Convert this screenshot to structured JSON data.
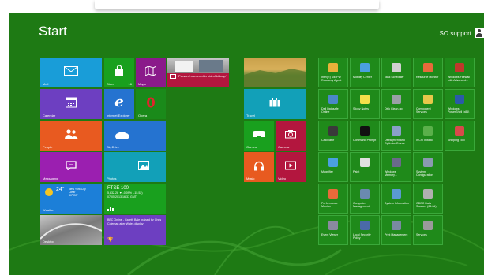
{
  "title": "Start",
  "user": {
    "name": "SO support"
  },
  "tiles": {
    "mail": {
      "label": "Mail"
    },
    "store": {
      "label": "Store",
      "badge": "16"
    },
    "maps": {
      "label": "Maps"
    },
    "photo_news": {
      "label": "Person 'murdered in bid of kidnap'"
    },
    "calendar": {
      "label": "Calendar"
    },
    "ie": {
      "label": "Internet Explorer"
    },
    "opera": {
      "label": "Opera"
    },
    "people": {
      "label": "People"
    },
    "skydrive": {
      "label": "SkyDrive"
    },
    "messaging": {
      "label": "Messaging"
    },
    "photos": {
      "label": "Photos"
    },
    "weather": {
      "label": "Weather",
      "temp": "24°",
      "city": "New York City",
      "cond": "Clear",
      "range": "30°/22°"
    },
    "finance": {
      "label": "FTSE 100",
      "value": "5,832.28 ▼ -0.09% (-15.52)",
      "date": "07/05/2013 16:37 GMT"
    },
    "desktop": {
      "label": "Desktop"
    },
    "sport": {
      "label": "BBC Online - Gareth Bale praised by Chris Coleman after Wales display"
    },
    "travel": {
      "label": "Travel"
    },
    "games": {
      "label": "Games"
    },
    "camera": {
      "label": "Camera"
    },
    "music": {
      "label": "Music"
    },
    "video": {
      "label": "Video"
    }
  },
  "admin_tiles": [
    {
      "label": "Intel(R) ME FW Recovery Agent",
      "color": "#e8b23a"
    },
    {
      "label": "Mobility Center",
      "color": "#4aa0e0"
    },
    {
      "label": "Task Scheduler",
      "color": "#d0d0d0"
    },
    {
      "label": "Resource Monitor",
      "color": "#e86a3a"
    },
    {
      "label": "Windows Firewall with Advanced...",
      "color": "#c0392b"
    },
    {
      "label": "Dell Datasafe Online",
      "color": "#4a88c8"
    },
    {
      "label": "Sticky Notes",
      "color": "#f5e04a"
    },
    {
      "label": "Disk Clean-up",
      "color": "#9aa0a6"
    },
    {
      "label": "Component Services",
      "color": "#e8c84a"
    },
    {
      "label": "Windows PowerShell (x86)",
      "color": "#2a5aa8"
    },
    {
      "label": "Calculator",
      "color": "#3a3a3a"
    },
    {
      "label": "Command Prompt",
      "color": "#111111"
    },
    {
      "label": "Defragment and Optimize Drives",
      "color": "#8aa0c8"
    },
    {
      "label": "iSCSI Initiator",
      "color": "#5ab04a"
    },
    {
      "label": "Snipping Tool",
      "color": "#d84a4a"
    },
    {
      "label": "Magnifier",
      "color": "#4aa0e0"
    },
    {
      "label": "Paint",
      "color": "#e0e0e0"
    },
    {
      "label": "Windows Memory...",
      "color": "#6a6a8a"
    },
    {
      "label": "System Configuration",
      "color": "#8a9ab0"
    },
    {
      "label": "Performance Monitor",
      "color": "#e86a3a"
    },
    {
      "label": "Computer Management",
      "color": "#6a8ab0"
    },
    {
      "label": "System Information",
      "color": "#5a9ad0"
    },
    {
      "label": "ODBC Data Sources (64-bit)",
      "color": "#b0b0b0"
    },
    {
      "label": "Event Viewer",
      "color": "#8a8aa0"
    },
    {
      "label": "Local Security Policy",
      "color": "#4a6aa8"
    },
    {
      "label": "Print Management",
      "color": "#7a8aa0"
    },
    {
      "label": "Services",
      "color": "#9a9a9a"
    }
  ]
}
